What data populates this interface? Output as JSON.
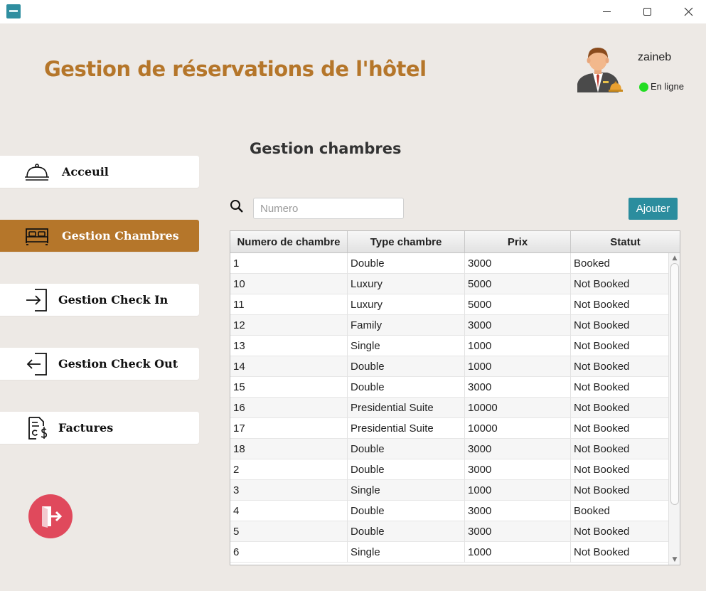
{
  "window": {
    "icon": "hotel-app-icon",
    "controls": [
      "minimize-icon",
      "maximize-icon",
      "close-icon"
    ]
  },
  "header": {
    "title": "Gestion de réservations de l'hôtel",
    "user": {
      "name": "zaineb",
      "status": "En ligne",
      "status_color": "#22dd22",
      "avatar": "receptionist-avatar"
    }
  },
  "sidebar": {
    "accent": "#b5762a",
    "items": [
      {
        "label": "Acceuil",
        "icon": "service-bell-icon",
        "active": false
      },
      {
        "label": "Gestion Chambres",
        "icon": "bed-icon",
        "active": true
      },
      {
        "label": "Gestion Check In",
        "icon": "check-in-icon",
        "active": false
      },
      {
        "label": "Gestion Check Out",
        "icon": "check-out-icon",
        "active": false
      },
      {
        "label": "Factures",
        "icon": "invoice-icon",
        "active": false
      }
    ],
    "logout_icon": "logout-door-icon",
    "logout_color": "#e0495c"
  },
  "main": {
    "title": "Gestion chambres",
    "search": {
      "placeholder": "Numero",
      "value": "",
      "icon": "search-icon"
    },
    "add_button": "Ajouter",
    "add_button_color": "#2b8d9e",
    "table": {
      "columns": [
        "Numero de chambre",
        "Type chambre",
        "Prix",
        "Statut"
      ],
      "rows": [
        [
          "1",
          "Double",
          "3000",
          "Booked"
        ],
        [
          "10",
          "Luxury",
          "5000",
          "Not Booked"
        ],
        [
          "11",
          "Luxury",
          "5000",
          "Not Booked"
        ],
        [
          "12",
          "Family",
          "3000",
          "Not Booked"
        ],
        [
          "13",
          "Single",
          "1000",
          "Not Booked"
        ],
        [
          "14",
          "Double",
          "1000",
          "Not Booked"
        ],
        [
          "15",
          "Double",
          "3000",
          "Not Booked"
        ],
        [
          "16",
          "Presidential Suite",
          "10000",
          "Not Booked"
        ],
        [
          "17",
          "Presidential Suite",
          "10000",
          "Not Booked"
        ],
        [
          "18",
          "Double",
          "3000",
          "Not Booked"
        ],
        [
          "2",
          "Double",
          "3000",
          "Not Booked"
        ],
        [
          "3",
          "Single",
          "1000",
          "Not Booked"
        ],
        [
          "4",
          "Double",
          "3000",
          "Booked"
        ],
        [
          "5",
          "Double",
          "3000",
          "Not Booked"
        ],
        [
          "6",
          "Single",
          "1000",
          "Not Booked"
        ]
      ]
    }
  }
}
